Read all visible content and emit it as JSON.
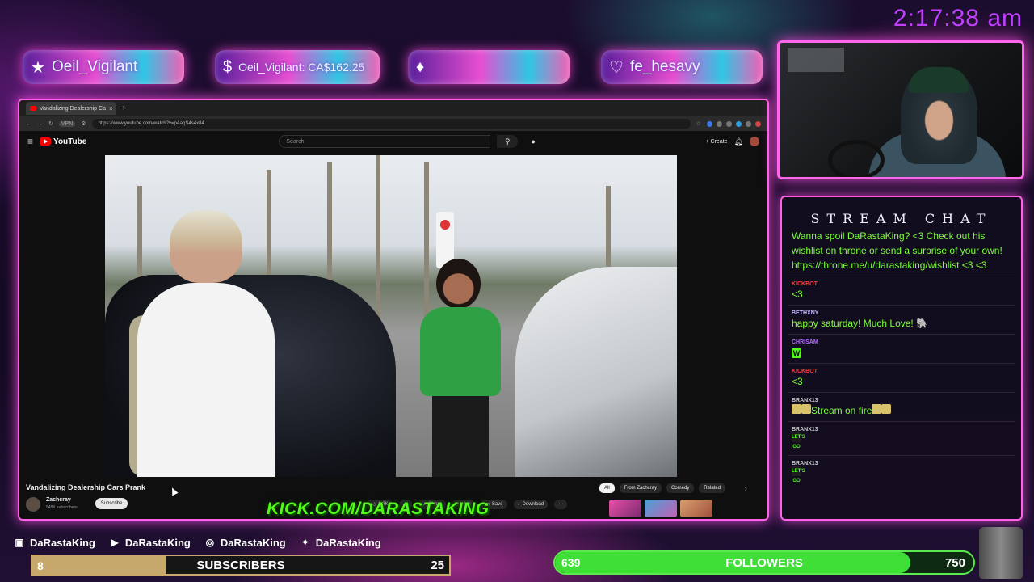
{
  "clock": "2:17:38 am",
  "banners": [
    {
      "icon": "star-icon",
      "glyph": "★",
      "text": "Oeil_Vigilant"
    },
    {
      "icon": "dollar-icon",
      "glyph": "$",
      "text": "Oeil_Vigilant: CA$162.25"
    },
    {
      "icon": "diamond-icon",
      "glyph": "♦",
      "text": ""
    },
    {
      "icon": "heart-icon",
      "glyph": "♡",
      "text": "fe_hesavy"
    }
  ],
  "browser": {
    "tab_title": "Vandalizing Dealership Ca",
    "tab_close": "×",
    "new_tab": "+",
    "vpn": "VPN",
    "url": "https://www.youtube.com/watch?v=pAaqS4s4x84"
  },
  "youtube": {
    "logo_text": "YouTube",
    "search_placeholder": "Search",
    "create_label": "+ Create",
    "video_title": "Vandalizing Dealership Cars Prank",
    "channel_name": "Zachcray",
    "channel_subs": "548K subscribers",
    "subscribe_label": "Subscribe",
    "actions": [
      "6.3K",
      "",
      "Share",
      "Ask",
      "Save",
      "Download",
      "···"
    ],
    "chips": [
      "All",
      "From Zachcray",
      "Comedy",
      "Related"
    ],
    "chip_next": "›"
  },
  "overlay_kick": "KICK.COM/DARASTAKING",
  "chat": {
    "title": "STREAM CHAT",
    "messages": [
      {
        "user": "",
        "user_color": "#ffffff",
        "text": "Wanna spoil DaRastaKing? <3 Check out his wishlist on throne or send a surprise of your own! https://throne.me/u/darastaking/wishlist <3 <3"
      },
      {
        "user": "KICKBOT",
        "user_color": "#ff3b3b",
        "text": "<3"
      },
      {
        "user": "BETHXNY",
        "user_color": "#c8b8ff",
        "text": "happy saturday! Much Love! 🐘"
      },
      {
        "user": "CHRISAM",
        "user_color": "#b36bff",
        "text": "W"
      },
      {
        "user": "KICKBOT",
        "user_color": "#ff3b3b",
        "text": "<3"
      },
      {
        "user": "BRANX13",
        "user_color": "#c8c8c8",
        "text": "Stream on fire"
      },
      {
        "user": "BRANX13",
        "user_color": "#c8c8c8",
        "text": "LET'S GO"
      },
      {
        "user": "BRANX13",
        "user_color": "#c8c8c8",
        "text": "LET'S GO"
      }
    ]
  },
  "socials": [
    {
      "icon": "twitch-icon",
      "glyph": "▣",
      "handle": "DaRastaKing"
    },
    {
      "icon": "youtube-icon",
      "glyph": "▶",
      "handle": "DaRastaKing"
    },
    {
      "icon": "instagram-icon",
      "glyph": "◎",
      "handle": "DaRastaKing"
    },
    {
      "icon": "twitter-icon",
      "glyph": "✦",
      "handle": "DaRastaKing"
    }
  ],
  "subscribers": {
    "current": "8",
    "label": "SUBSCRIBERS",
    "goal": "25",
    "progress": 0.32
  },
  "followers": {
    "current": "639",
    "label": "FOLLOWERS",
    "goal": "750",
    "progress": 0.85
  },
  "colors": {
    "accent_pink": "#ff62e8",
    "kick_green": "#53fc18",
    "chat_green": "#7cff3a",
    "clock_purple": "#c040ff"
  }
}
